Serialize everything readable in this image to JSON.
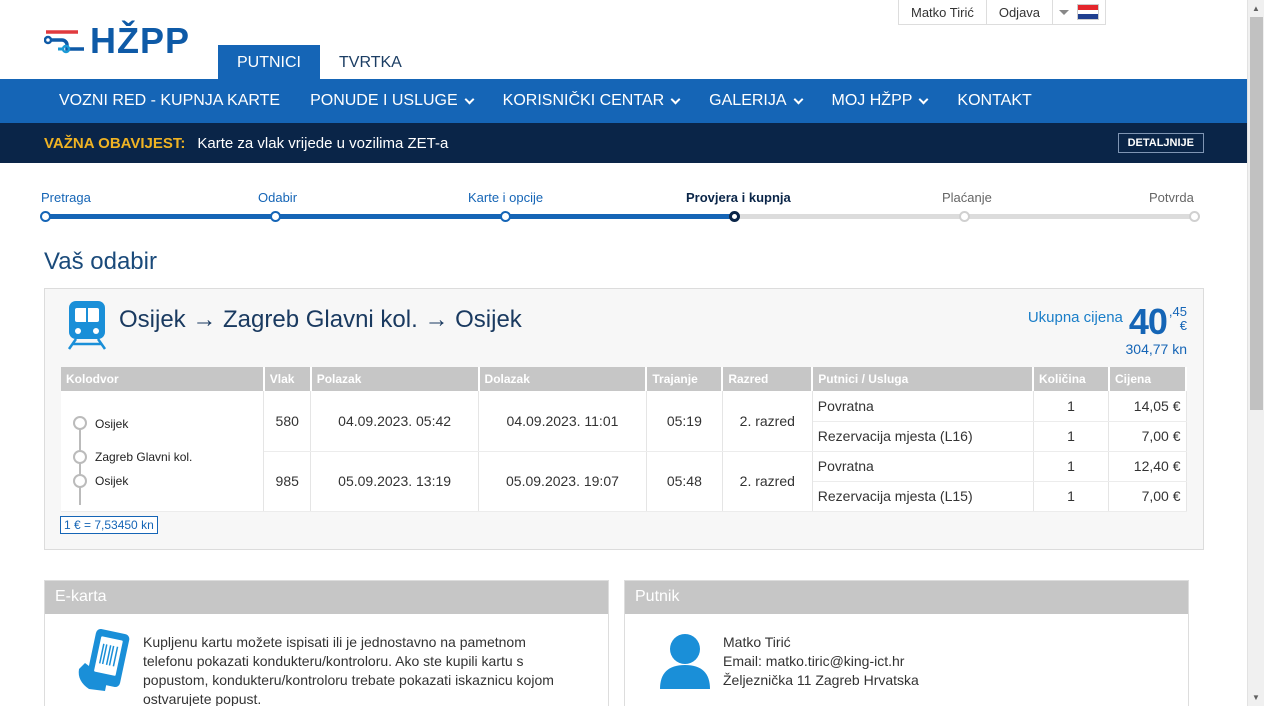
{
  "header": {
    "logo_text": "HŽPP",
    "tabs": [
      {
        "label": "PUTNICI",
        "active": true
      },
      {
        "label": "TVRTKA",
        "active": false
      }
    ],
    "user": {
      "name": "Matko Tirić",
      "logout": "Odjava"
    }
  },
  "nav": {
    "items": [
      {
        "label": "VOZNI RED - KUPNJA KARTE"
      },
      {
        "label": "PONUDE I USLUGE"
      },
      {
        "label": "KORISNIČKI CENTAR"
      },
      {
        "label": "GALERIJA"
      },
      {
        "label": "MOJ HŽPP"
      },
      {
        "label": "KONTAKT"
      }
    ]
  },
  "notice": {
    "label": "VAŽNA OBAVIJEST:",
    "message": "Karte za vlak vrijede u vozilima ZET-a",
    "button": "DETALJNIJE"
  },
  "steps": [
    {
      "label": "Pretraga",
      "state": "done"
    },
    {
      "label": "Odabir",
      "state": "done"
    },
    {
      "label": "Karte i opcije",
      "state": "done"
    },
    {
      "label": "Provjera i kupnja",
      "state": "current"
    },
    {
      "label": "Plaćanje",
      "state": "future"
    },
    {
      "label": "Potvrda",
      "state": "future"
    }
  ],
  "page_title": "Vaš odabir",
  "selection": {
    "route": "Osijek → Zagreb Glavni kol. → Osijek",
    "total_label": "Ukupna cijena",
    "total_int": "40",
    "total_dec": ",45",
    "total_currency": "€",
    "total_kn": "304,77 kn",
    "columns": [
      "Kolodvor",
      "Vlak",
      "Polazak",
      "Dolazak",
      "Trajanje",
      "Razred",
      "Putnici / Usluga",
      "Količina",
      "Cijena"
    ],
    "stations": [
      "Osijek",
      "Zagreb Glavni kol.",
      "Osijek"
    ],
    "trips": [
      {
        "train": "580",
        "departure": "04.09.2023. 05:42",
        "arrival": "04.09.2023. 11:01",
        "duration": "05:19",
        "class": "2. razred",
        "services": [
          {
            "name": "Povratna",
            "qty": "1",
            "price": "14,05 €"
          },
          {
            "name": "Rezervacija mjesta (L16)",
            "qty": "1",
            "price": "7,00 €"
          }
        ]
      },
      {
        "train": "985",
        "departure": "05.09.2023. 13:19",
        "arrival": "05.09.2023. 19:07",
        "duration": "05:48",
        "class": "2. razred",
        "services": [
          {
            "name": "Povratna",
            "qty": "1",
            "price": "12,40 €"
          },
          {
            "name": "Rezervacija mjesta (L15)",
            "qty": "1",
            "price": "7,00 €"
          }
        ]
      }
    ],
    "rate": "1 € = 7,53450 kn"
  },
  "ekarta": {
    "title": "E-karta",
    "text": "Kupljenu kartu možete ispisati ili je jednostavno na pametnom telefonu pokazati kondukteru/kontroloru. Ako ste kupili kartu s popustom, kondukteru/kontroloru trebate pokazati iskaznicu kojom ostvarujete popust."
  },
  "putnik": {
    "title": "Putnik",
    "name": "Matko Tirić",
    "email": "Email: matko.tiric@king-ict.hr",
    "address": "Željeznička 11 Zagreb Hrvatska"
  },
  "colors": {
    "primary": "#1565b6",
    "dark_navy": "#0a2548",
    "notice_label": "#f0b323",
    "table_header": "#c6c6c6"
  }
}
